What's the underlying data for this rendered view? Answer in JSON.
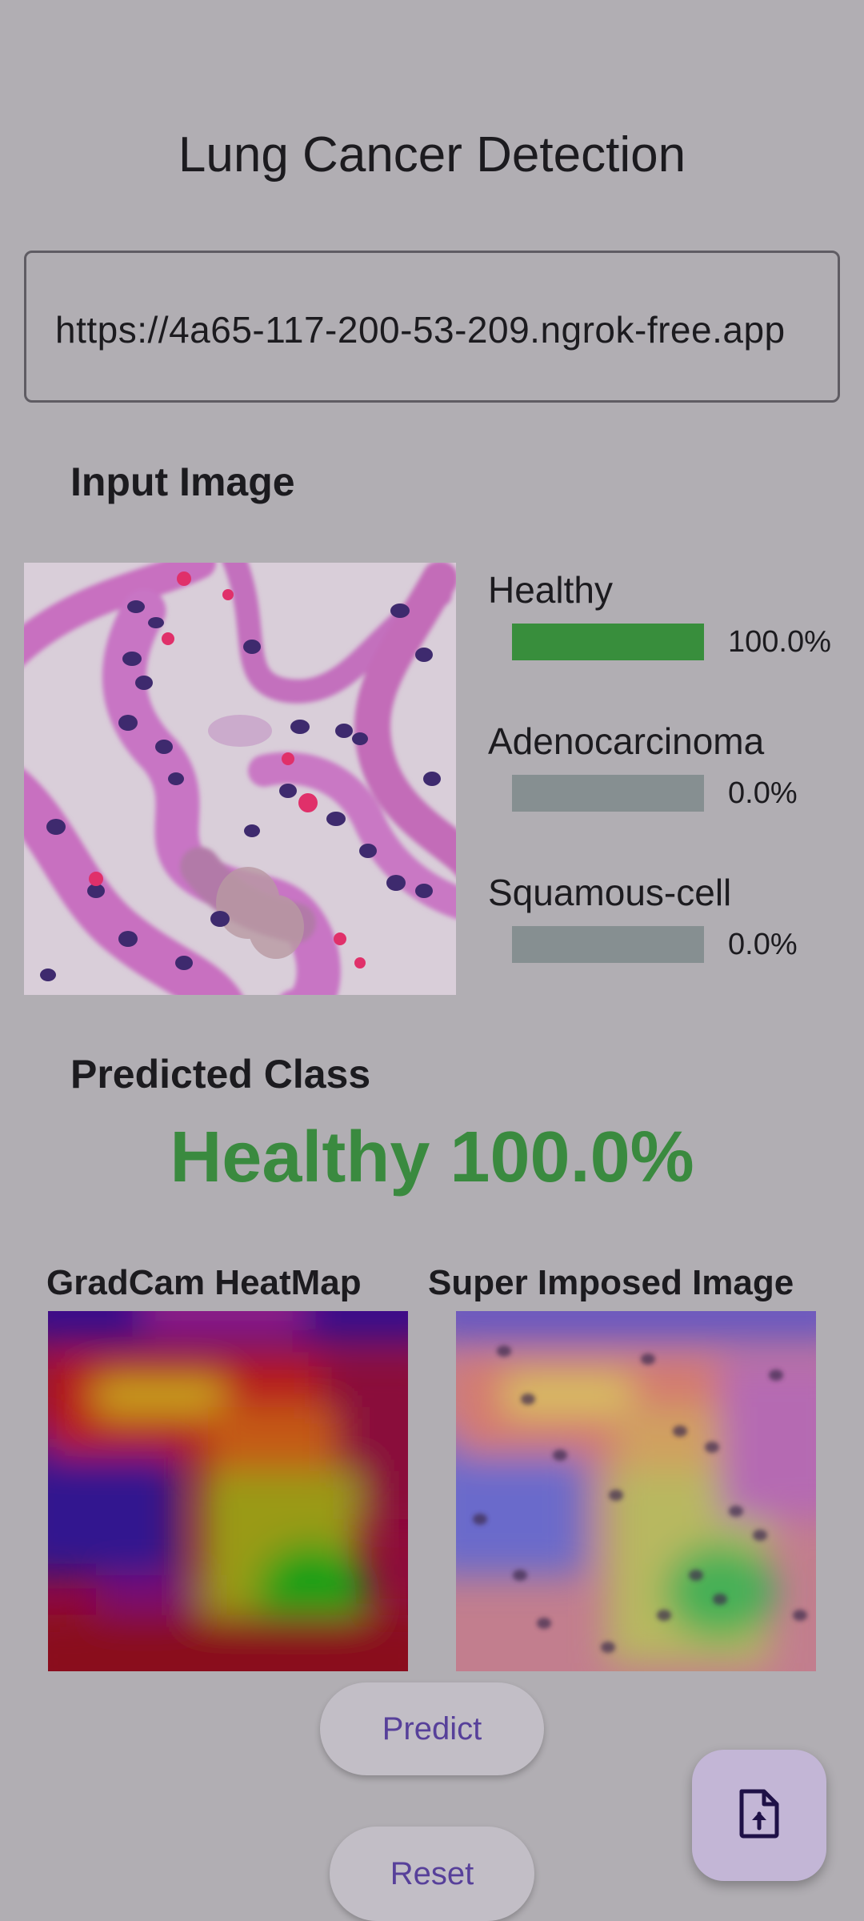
{
  "status_bar": {
    "left_text": "",
    "right_text": ""
  },
  "app": {
    "title": "Lung Cancer Detection"
  },
  "url_input": {
    "value": "https://4a65-117-200-53-209.ngrok-free.app"
  },
  "input_image": {
    "label": "Input Image"
  },
  "predictions": [
    {
      "name": "Healthy",
      "percent_label": "100.0%",
      "fraction": 1.0,
      "bar_color": "#388e3c"
    },
    {
      "name": "Adenocarcinoma",
      "percent_label": "0.0%",
      "fraction": 0.0,
      "bar_color": "#388e3c"
    },
    {
      "name": "Squamous-cell",
      "percent_label": "0.0%",
      "fraction": 0.0,
      "bar_color": "#388e3c"
    }
  ],
  "predicted_class": {
    "label": "Predicted Class",
    "value": "Healthy 100.0%",
    "color": "#3a8a3f"
  },
  "gradcam": {
    "heatmap_label": "GradCam HeatMap",
    "superimposed_label": "Super Imposed Image"
  },
  "buttons": {
    "predict": "Predict",
    "reset": "Reset"
  },
  "fab": {
    "icon": "upload-file-icon"
  },
  "colors": {
    "background_scrim": "#b1aeb3",
    "accent": "#57409a",
    "bar_track": "#868f91",
    "success": "#3a8a3f"
  }
}
